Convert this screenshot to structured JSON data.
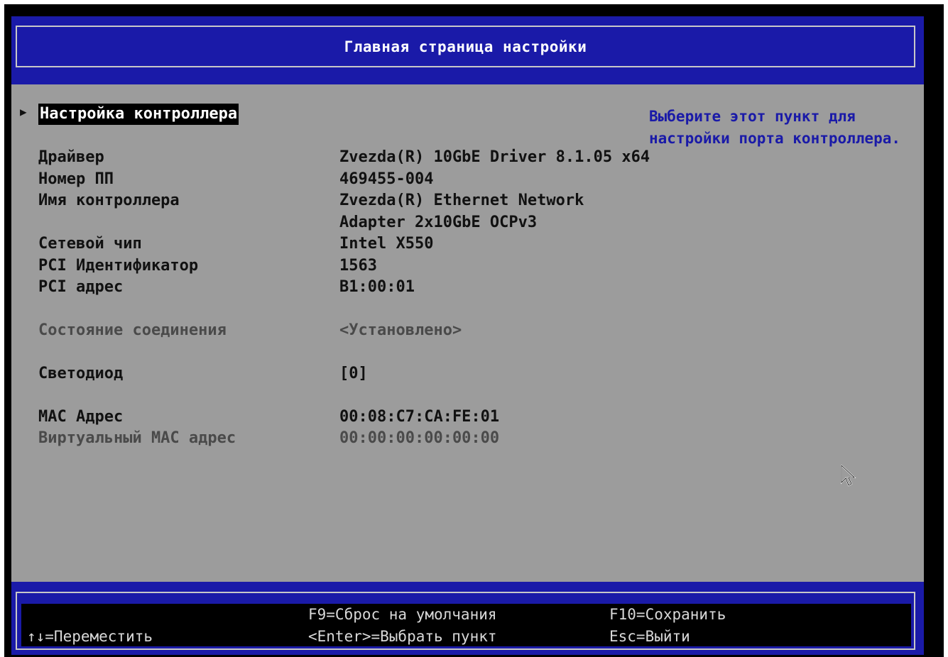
{
  "header": {
    "title": "Главная страница настройки"
  },
  "menu": {
    "selected_label": "Настройка контроллера"
  },
  "help_text": {
    "line1": "Выберите этот пункт для",
    "line2": "настройки порта контроллера."
  },
  "info": {
    "driver_label": "Драйвер",
    "driver_value": "Zvezda(R) 10GbE Driver 8.1.05 x64",
    "part_label": "Номер ПП",
    "part_value": "469455-004",
    "controller_label": "Имя контроллера",
    "controller_value_line1": "Zvezda(R) Ethernet Network",
    "controller_value_line2": "Adapter 2x10GbE OCPv3",
    "chip_label": "Сетевой чип",
    "chip_value": "Intel X550",
    "pci_id_label": "PCI Идентификатор",
    "pci_id_value": "1563",
    "pci_addr_label": "PCI адрес",
    "pci_addr_value": "B1:00:01",
    "link_label": "Состояние соединения",
    "link_value": "<Установлено>",
    "led_label": "Светодиод",
    "led_value": "[0]",
    "mac_label": "MAC Адрес",
    "mac_value": "00:08:C7:CA:FE:01",
    "vmac_label": "Виртуальный MAC адрес",
    "vmac_value": "00:00:00:00:00:00"
  },
  "footer": {
    "move": "↑↓=Переместить",
    "f9": "F9=Сброс на умолчания",
    "enter": "<Enter>=Выбрать пункт",
    "f10": "F10=Сохранить",
    "esc": "Esc=Выйти"
  },
  "colors": {
    "panel_bg": "#9c9c9c",
    "bar_blue": "#1a1aa8",
    "help_blue": "#1a1aa8"
  },
  "icons": {
    "pointer": "mouse-cursor-icon",
    "selection": "triangle-right-icon"
  }
}
